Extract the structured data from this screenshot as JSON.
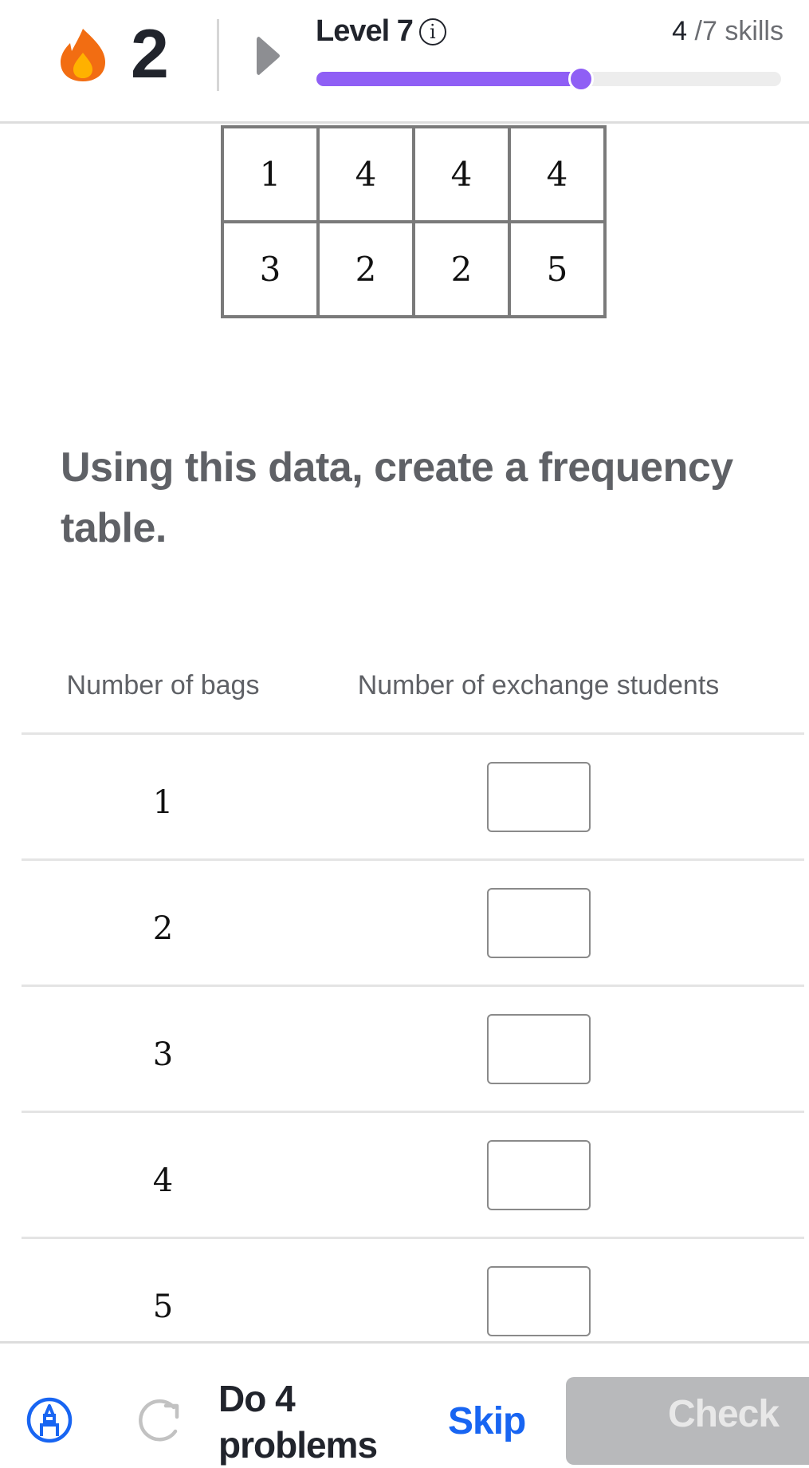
{
  "header": {
    "streak_count": "2",
    "level_label": "Level 7",
    "info_glyph": "i",
    "skills_done": "4",
    "skills_total_label": " /7 skills",
    "progress_fraction": 0.57,
    "colors": {
      "accent": "#8f5ff5",
      "flame": "#f26d12",
      "flame_inner": "#ffb100"
    }
  },
  "data_table": {
    "rows": [
      [
        "1",
        "4",
        "4",
        "4"
      ],
      [
        "3",
        "2",
        "2",
        "5"
      ]
    ]
  },
  "prompt": "Using this data, create a frequency table.",
  "frequency_table": {
    "headers": [
      "Number of bags",
      "Number of exchange students"
    ],
    "rows": [
      {
        "value": "1",
        "answer": ""
      },
      {
        "value": "2",
        "answer": ""
      },
      {
        "value": "3",
        "answer": ""
      },
      {
        "value": "4",
        "answer": ""
      },
      {
        "value": "5",
        "answer": ""
      }
    ]
  },
  "footer": {
    "do_problems_label": "Do 4 problems",
    "skip_label": "Skip",
    "check_label": "Check",
    "colors": {
      "link": "#1865f2",
      "disabled": "#b8b9bb"
    }
  }
}
